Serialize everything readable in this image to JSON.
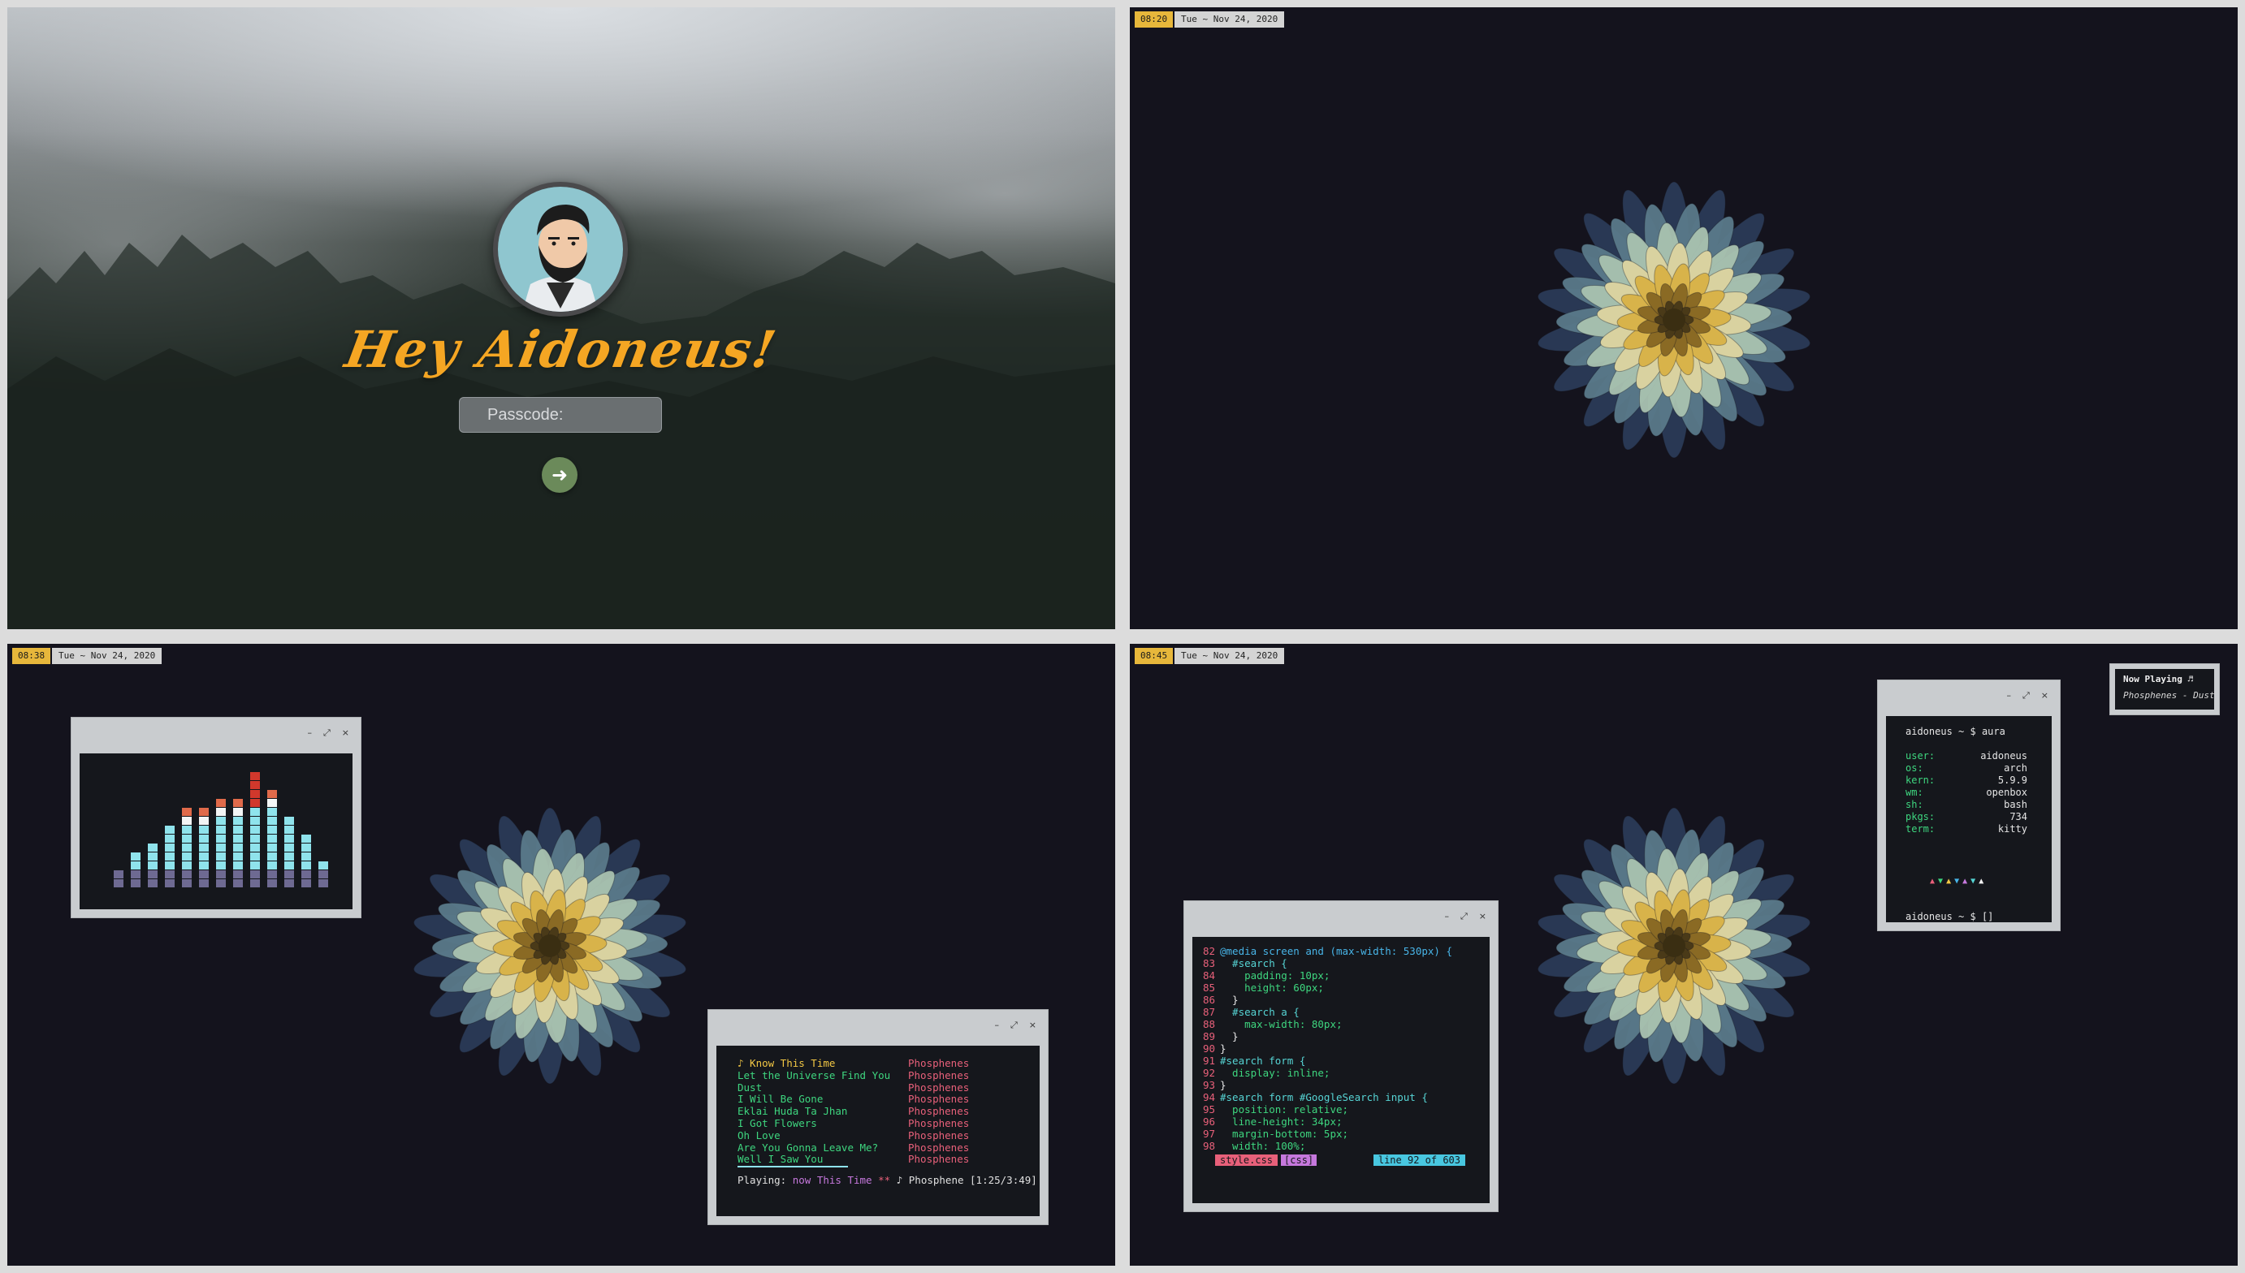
{
  "lockscreen": {
    "greeting": "Hey Aidoneus!",
    "passcode_placeholder": "Passcode:",
    "submit_icon": "arrow-right-icon"
  },
  "topbar": [
    {
      "time": "08:20",
      "date": "Tue ~ Nov 24, 2020"
    },
    {
      "time": "08:38",
      "date": "Tue ~ Nov 24, 2020"
    },
    {
      "time": "08:45",
      "date": "Tue ~ Nov 24, 2020"
    }
  ],
  "window_controls": {
    "minimize": "–",
    "maximize": "⤢",
    "close": "×"
  },
  "visualizer": {
    "bars": [
      2,
      4,
      5,
      7,
      9,
      9,
      10,
      10,
      13,
      11,
      8,
      6,
      3
    ],
    "colors": {
      "base": "#6e6a92",
      "mid": "#8fe3ec",
      "top": "#f3f5f5",
      "warm": "#e06a4a",
      "hot": "#d1382c"
    }
  },
  "player": {
    "tracks": [
      {
        "title": "♪ Know This Time",
        "artist": "Phosphenes"
      },
      {
        "title": "Let the Universe Find You",
        "artist": "Phosphenes"
      },
      {
        "title": "Dust",
        "artist": "Phosphenes"
      },
      {
        "title": "I Will Be Gone",
        "artist": "Phosphenes"
      },
      {
        "title": "Eklai Huda Ta Jhan",
        "artist": "Phosphenes"
      },
      {
        "title": "I Got Flowers",
        "artist": "Phosphenes"
      },
      {
        "title": "Oh Love",
        "artist": "Phosphenes"
      },
      {
        "title": "Are You Gonna Leave Me?",
        "artist": "Phosphenes"
      },
      {
        "title": "Well I Saw You",
        "artist": "Phosphenes"
      }
    ],
    "status_label": "Playing:",
    "status_track": "now This Time",
    "status_sep": "**",
    "status_rest": "♪ Phosphene [1:25/3:49]"
  },
  "editor": {
    "lines": [
      {
        "n": "82",
        "text": "@media screen and (max-width: 530px) {"
      },
      {
        "n": "83",
        "text": "  #search {"
      },
      {
        "n": "84",
        "text": "    padding: 10px;"
      },
      {
        "n": "85",
        "text": "    height: 60px;"
      },
      {
        "n": "86",
        "text": "  }"
      },
      {
        "n": "87",
        "text": "  #search a {"
      },
      {
        "n": "88",
        "text": "    max-width: 80px;"
      },
      {
        "n": "89",
        "text": "  }"
      },
      {
        "n": "90",
        "text": "}"
      },
      {
        "n": "91",
        "text": "#search form {"
      },
      {
        "n": "92",
        "text": "  display: inline;"
      },
      {
        "n": "93",
        "text": "}"
      },
      {
        "n": "94",
        "text": "#search form #GoogleSearch input {"
      },
      {
        "n": "95",
        "text": "  position: relative;"
      },
      {
        "n": "96",
        "text": "  line-height: 34px;"
      },
      {
        "n": "97",
        "text": "  margin-bottom: 5px;"
      },
      {
        "n": "98",
        "text": "  width: 100%;"
      }
    ],
    "status_file": "style.css",
    "status_type": "[css]",
    "status_pos": "line 92 of 603"
  },
  "terminal": {
    "prompt": "aidoneus ~ $",
    "command": "aura",
    "info": [
      {
        "key": "user:",
        "value": "aidoneus"
      },
      {
        "key": "os:",
        "value": "arch"
      },
      {
        "key": "kern:",
        "value": "5.9.9"
      },
      {
        "key": "wm:",
        "value": "openbox"
      },
      {
        "key": "sh:",
        "value": "bash"
      },
      {
        "key": "pkgs:",
        "value": "734"
      },
      {
        "key": "term:",
        "value": "kitty"
      }
    ],
    "triangles": "▲▼▲▼▲▼▲",
    "triangle_colors": [
      "#e8607a",
      "#3ed67f",
      "#f2c744",
      "#48b5e8",
      "#c678dd",
      "#56d4d4",
      "#f2f2f2"
    ],
    "cursor": "[]"
  },
  "now_playing": {
    "title": "Now Playing ♬",
    "track": "Phosphenes - Dust"
  }
}
